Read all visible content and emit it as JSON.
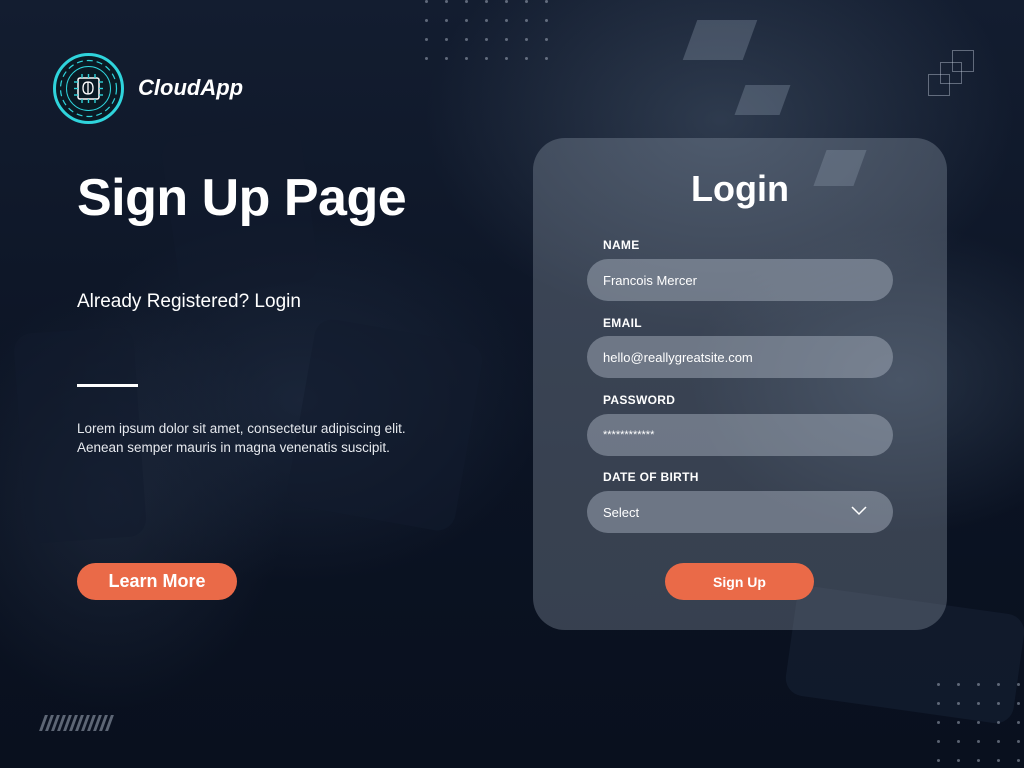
{
  "brand": {
    "name": "CloudApp",
    "logo_icon": "brain-chip-icon",
    "accent": "#2fd4dc"
  },
  "hero": {
    "title": "Sign Up Page",
    "already_registered": "Already Registered? Login",
    "description_line1": "Lorem ipsum dolor sit amet, consectetur adipiscing elit.",
    "description_line2": "Aenean semper mauris in magna venenatis suscipit.",
    "learn_more_label": "Learn More"
  },
  "form": {
    "title": "Login",
    "name": {
      "label": "NAME",
      "value": "Francois Mercer"
    },
    "email": {
      "label": "EMAIL",
      "value": "hello@reallygreatsite.com"
    },
    "password": {
      "label": "PASSWORD",
      "value": "************"
    },
    "dob": {
      "label": "DATE OF BIRTH",
      "value": "Select",
      "icon": "chevron-down-icon"
    },
    "submit_label": "Sign Up"
  },
  "colors": {
    "button": "#ea6a48",
    "background": "#0d1628"
  }
}
